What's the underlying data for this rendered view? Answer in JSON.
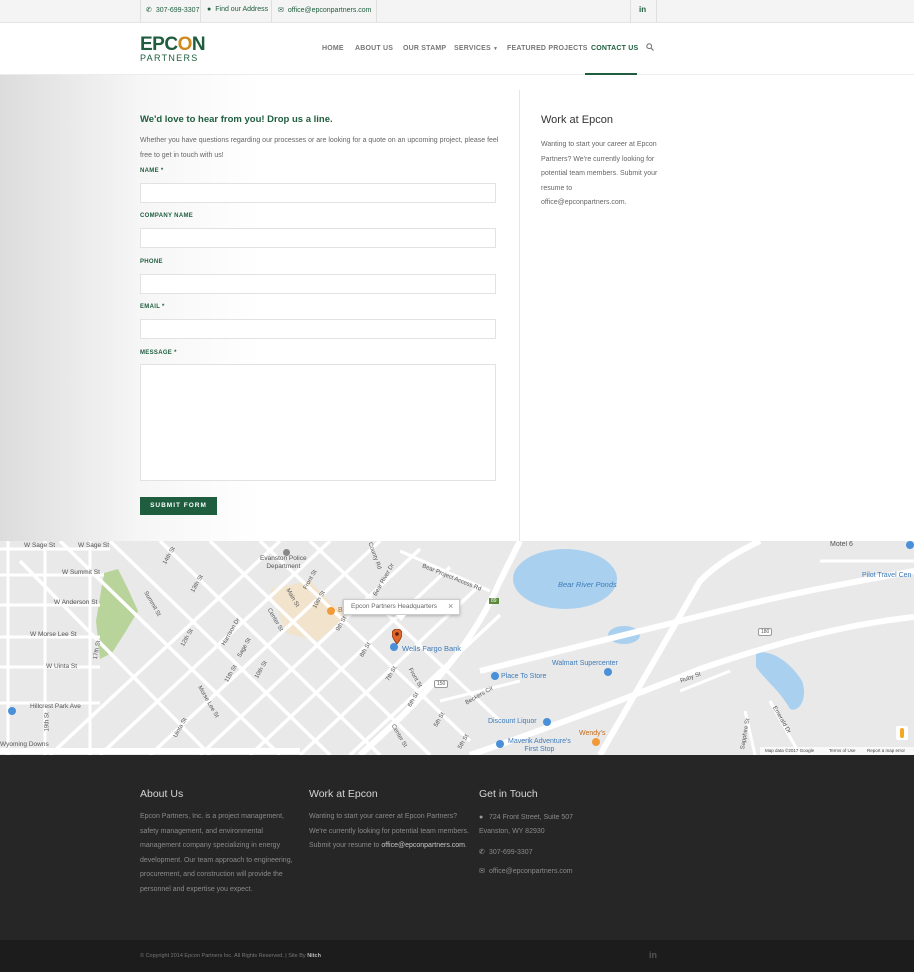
{
  "topbar": {
    "phone": "307-699-3307",
    "address_link": "Find our Address",
    "email": "office@epconpartners.com",
    "social": "in"
  },
  "logo": {
    "line1_a": "EPC",
    "line1_b": "O",
    "line1_c": "N",
    "line2": "PARTNERS"
  },
  "nav": {
    "items": [
      "HOME",
      "ABOUT US",
      "OUR STAMP",
      "SERVICES",
      "FEATURED PROJECTS",
      "CONTACT US"
    ],
    "active": "CONTACT US",
    "search_icon": "search-icon",
    "caret_icon": "chevron-down-icon"
  },
  "form": {
    "heading": "We'd love to hear from you! Drop us a line.",
    "intro": "Whether you have questions regarding our processes or are looking for a quote on an upcoming project, please feel free to get in touch with us!",
    "labels": {
      "name": "NAME *",
      "company": "COMPANY NAME",
      "phone": "PHONE",
      "email": "EMAIL *",
      "message": "MESSAGE *"
    },
    "submit": "SUBMIT FORM"
  },
  "sidebar": {
    "title": "Work at Epcon",
    "text": "Wanting to start your career at Epcon Partners? We're currently looking for potential team members. Submit your resume to office@epconpartners.com."
  },
  "map": {
    "popup": "Epcon Partners Headquarters",
    "close": "×",
    "labels": {
      "w_sage_1": "W Sage St",
      "w_sage_2": "W Sage St",
      "w_summit": "W Summit St",
      "w_anderson": "W Anderson St",
      "w_morse": "W Morse Lee St",
      "w_uinta": "W Uinta St",
      "hillcrest": "Hillcrest Park Ave",
      "wyoming": "Wyoming Downs",
      "police": "Evanston Police",
      "police2": "Department",
      "bear_river": "Bear River Ponds",
      "wells": "Wells Fargo Bank",
      "walmart": "Walmart Supercenter",
      "place": "Place To Store",
      "discount": "Discount Liquor",
      "wendys": "Wendy's",
      "maverik": "Maverik Adventure's",
      "maverik2": "First Stop",
      "motel": "Motel 6",
      "pilot": "Pilot Travel Cen",
      "bear_project": "Bear Project Access Rd",
      "ruby": "Ruby St",
      "emerald": "Emerald Dr",
      "sapphire": "Sapphire St",
      "county": "County Rd",
      "bear_rd": "Bear River Dr",
      "front": "Front St",
      "summit": "Summit St",
      "sage": "Sage St",
      "uinta": "Uinta St",
      "morse": "Morse Lee St",
      "harrison": "Harrison Dr",
      "main": "Main St",
      "center": "Center St",
      "tenth": "10th St",
      "ninth": "9th St",
      "eighth": "8th St",
      "seventh": "7th St",
      "sixth": "6th St",
      "fifth": "5th St",
      "twelfth": "12th St",
      "eleventh": "11th St",
      "thirteenth": "13th St",
      "fourteenth": "14th St",
      "nineteenth": "19th St",
      "seventeenth": "17th St",
      "beckers": "Beckers Cir",
      "b": "B",
      "r150": "150",
      "r180": "180",
      "r89": "89"
    },
    "footer_attrib": [
      "Map data ©2017 Google",
      "Terms of Use",
      "Report a map error"
    ]
  },
  "footer": {
    "about_title": "About Us",
    "about_text": "Epcon Partners, Inc. is a project management, safety management, and environmental management company specializing in energy development. Our team approach to engineering, procurement, and construction will provide the personnel and expertise you expect.",
    "work_title": "Work at Epcon",
    "work_text": "Wanting to start your career at Epcon Partners? We're currently looking for potential team members. Submit your resume to",
    "work_email": "office@epconpartners.com",
    "work_end": ".",
    "touch_title": "Get in Touch",
    "address1": "724 Front Street, Suite 507",
    "address2": "Evanston, WY 82930",
    "phone": "307-699-3307",
    "email": "office@epconpartners.com"
  },
  "bottom": {
    "copyright": "© Copyright 2014 Epcon Partners Inc. All Rights Reserved. | Site By",
    "site_by": "Nitch",
    "social": "in"
  }
}
